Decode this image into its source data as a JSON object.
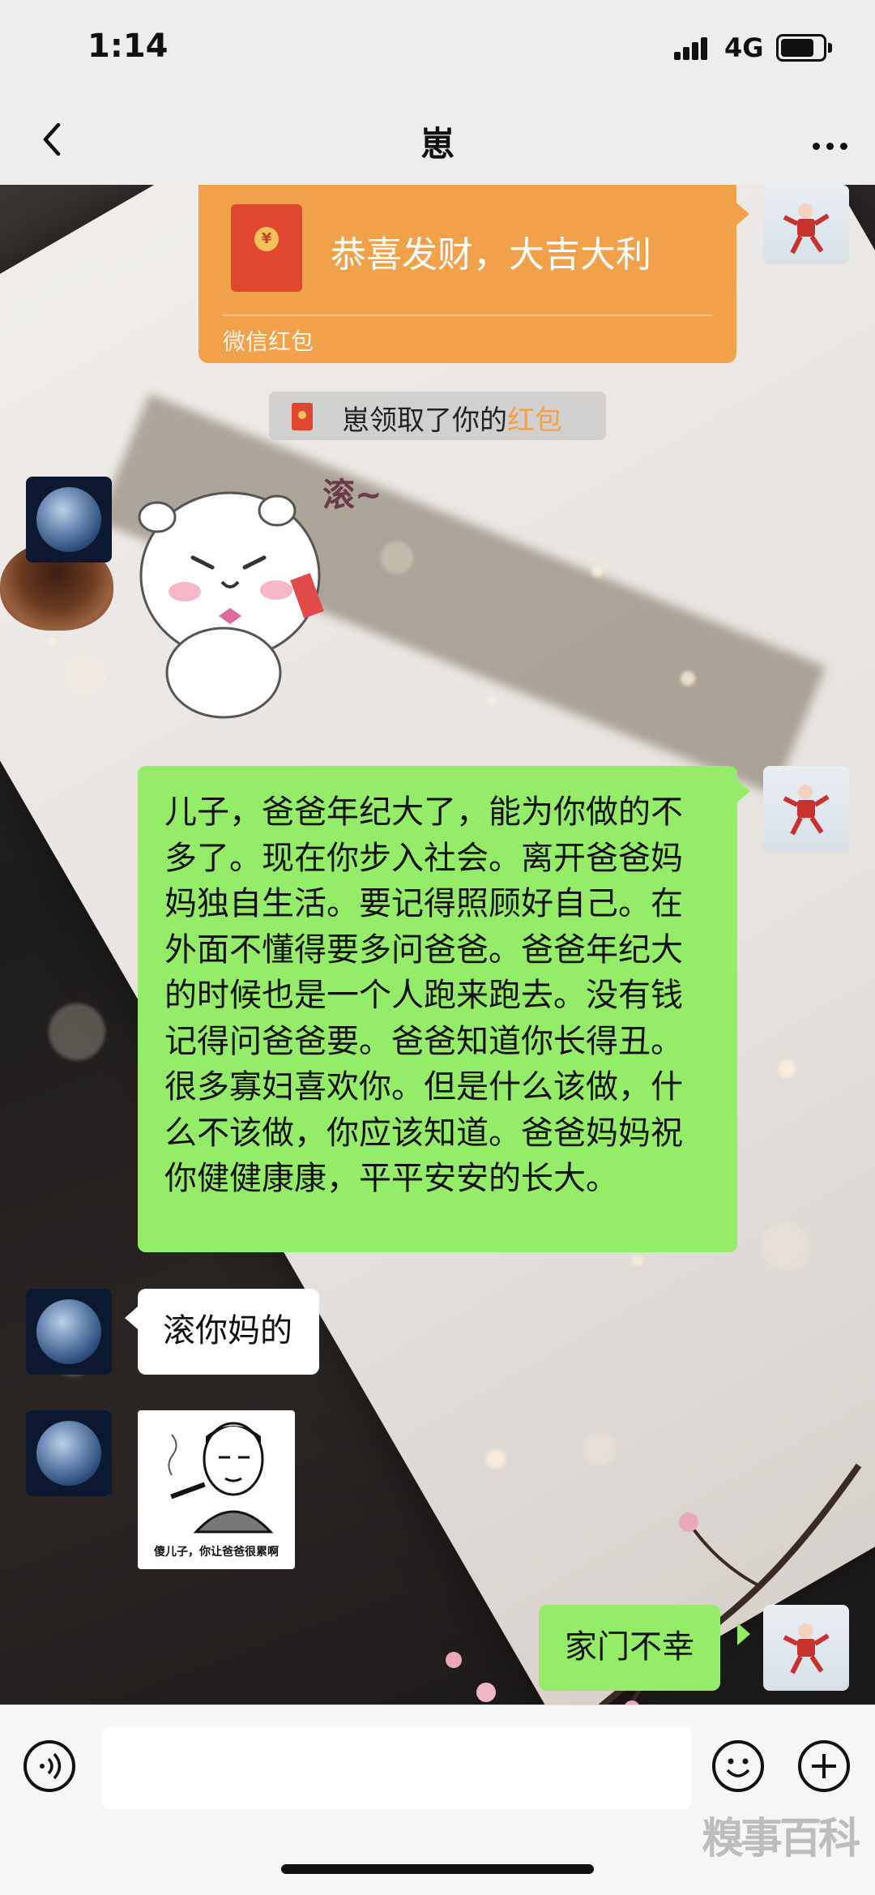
{
  "status_bar": {
    "time": "1:14",
    "network": "4G"
  },
  "nav": {
    "title": "崽"
  },
  "red_packet": {
    "greeting": "恭喜发财，大吉大利",
    "label": "微信红包"
  },
  "notice": {
    "prefix": "崽领取了你的",
    "highlight": "红包"
  },
  "sticker": {
    "caption": "滚~"
  },
  "messages": {
    "dad_long": "儿子，爸爸年纪大了，能为你做的不多了。现在你步入社会。离开爸爸妈妈独自生活。要记得照顾好自己。在外面不懂得要多问爸爸。爸爸年纪大的时候也是一个人跑来跑去。没有钱记得问爸爸要。爸爸知道你长得丑。很多寡妇喜欢你。但是什么该做，什么不该做，你应该知道。爸爸妈妈祝你健健康康，平平安安的长大。",
    "son_reply": "滚你妈的",
    "meme_caption": "傻儿子，你让爸爸很累啊",
    "dad_last": "家门不幸"
  },
  "watermark": "糗事百科",
  "colors": {
    "my_bubble": "#95ec69",
    "their_bubble": "#ffffff",
    "red_packet": "#f0a14a",
    "nav_bg": "#ededed"
  },
  "icons": [
    "back-icon",
    "more-icon",
    "voice-icon",
    "emoji-icon",
    "plus-icon"
  ]
}
